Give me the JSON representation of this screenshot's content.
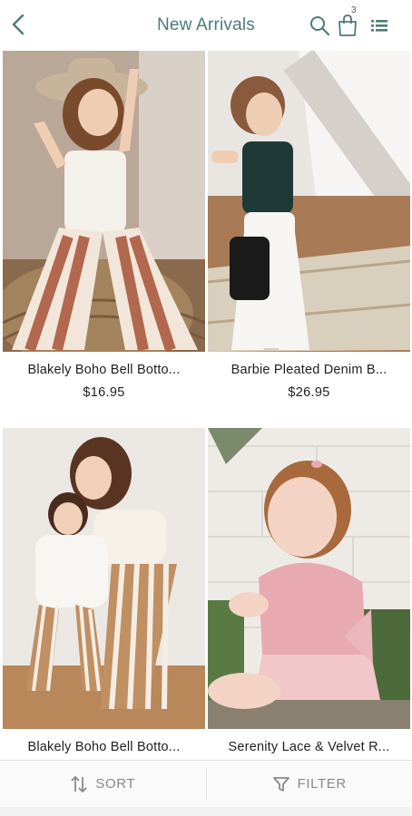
{
  "header": {
    "title": "New Arrivals",
    "cart_count": "3",
    "icons": [
      "back-arrow-icon",
      "search-icon",
      "shopping-bag-icon",
      "list-menu-icon"
    ],
    "accent_color": "#4a7c7a"
  },
  "products": [
    {
      "name": "Blakely Boho Bell Botto...",
      "price": "$16.95"
    },
    {
      "name": "Barbie Pleated Denim B...",
      "price": "$26.95"
    },
    {
      "name": "Blakely Boho Bell Botto...",
      "price": ""
    },
    {
      "name": "Serenity Lace & Velvet R...",
      "price": ""
    }
  ],
  "bottom_bar": {
    "sort_label": "SORT",
    "filter_label": "FILTER"
  }
}
